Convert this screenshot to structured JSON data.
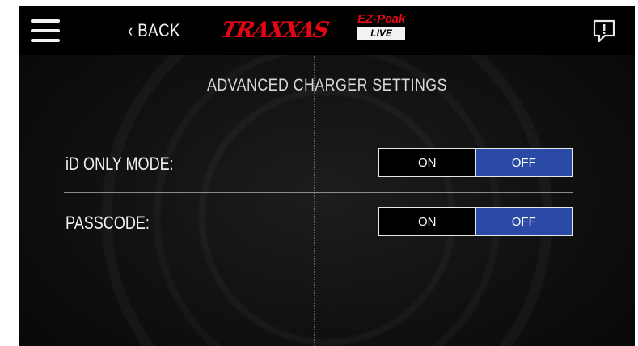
{
  "header": {
    "back_label": "‹ BACK",
    "brand": "TRAXXAS",
    "sublogo_top": "EZ-Peak",
    "sublogo_bottom": "LIVE",
    "menu_icon": "hamburger-menu-icon",
    "feedback_icon": "feedback-speech-bubble-icon"
  },
  "page": {
    "title": "ADVANCED CHARGER SETTINGS"
  },
  "settings": [
    {
      "label": "iD ONLY MODE:",
      "on_label": "ON",
      "off_label": "OFF",
      "selected": "OFF"
    },
    {
      "label": "PASSCODE:",
      "on_label": "ON",
      "off_label": "OFF",
      "selected": "OFF"
    }
  ],
  "colors": {
    "selected": "#2b4aa6",
    "unselected": "#000000",
    "brand": "#e30613"
  }
}
